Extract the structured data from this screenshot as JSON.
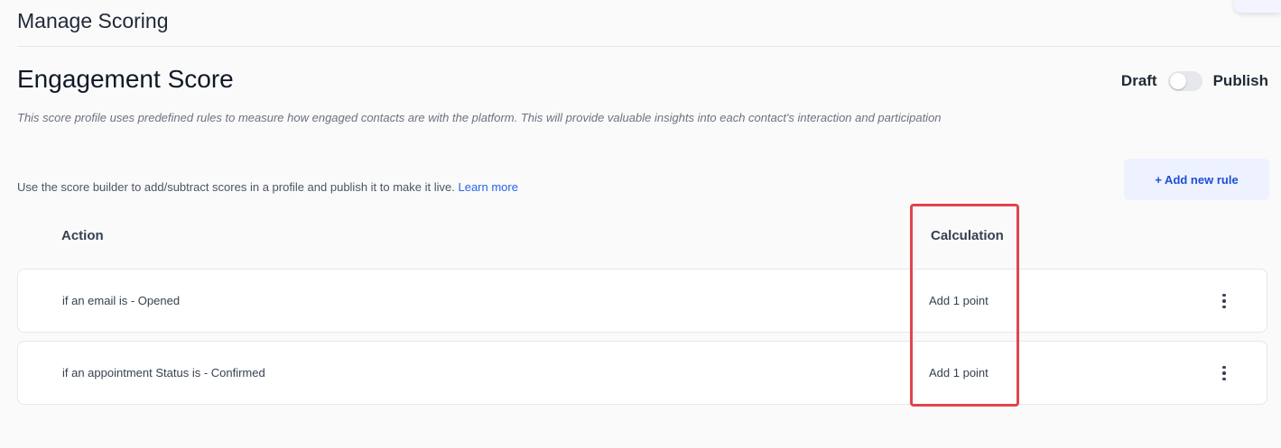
{
  "header": {
    "title": "Manage Scoring"
  },
  "profile": {
    "title": "Engagement Score",
    "description": "This score profile uses predefined rules to measure how engaged contacts are with the platform. This will provide valuable insights into each contact's interaction and participation",
    "toggle": {
      "draft_label": "Draft",
      "publish_label": "Publish",
      "state": "draft"
    }
  },
  "builder": {
    "hint": "Use the score builder to add/subtract scores in a profile and publish it to make it live. ",
    "learn_more": "Learn more",
    "add_rule_label": "+ Add new rule"
  },
  "table": {
    "columns": {
      "action": "Action",
      "calculation": "Calculation"
    },
    "rows": [
      {
        "action": "if an email is - Opened",
        "calculation": "Add 1 point"
      },
      {
        "action": "if an appointment Status is - Confirmed",
        "calculation": "Add 1 point"
      }
    ]
  },
  "colors": {
    "highlight": "#e0454a",
    "accent": "#2563eb"
  },
  "icons": {
    "row_menu": "more-vertical-icon"
  }
}
